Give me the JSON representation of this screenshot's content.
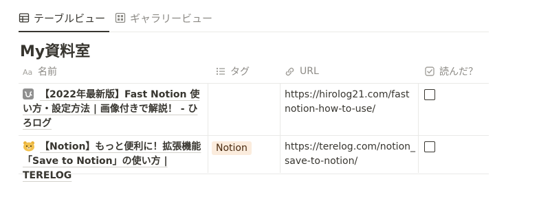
{
  "tabs": [
    {
      "label": "テーブルビュー",
      "icon": "table-icon",
      "active": true
    },
    {
      "label": "ギャラリービュー",
      "icon": "gallery-icon",
      "active": false
    }
  ],
  "database": {
    "title": "My資料室"
  },
  "columns": [
    {
      "label": "名前",
      "icon": "text-property-icon"
    },
    {
      "label": "タグ",
      "icon": "list-property-icon"
    },
    {
      "label": "URL",
      "icon": "link-icon"
    },
    {
      "label": "読んだ？",
      "icon": "checkbox-property-icon"
    }
  ],
  "rows": [
    {
      "name": "【2022年最新版】Fast Notion 使い方・設定方法 | 画像付きで解説！ - ひろログ",
      "page_icon": "hiragana-hi-icon",
      "tag": "",
      "url": "https://hirolog21.com/fastnotion-how-to-use/",
      "read": false
    },
    {
      "name": "【Notion】もっと便利に！拡張機能「Save to Notion」の使い方 | TERELOG",
      "page_icon": "bear-face-icon",
      "tag": "Notion",
      "url": "https://terelog.com/notion_save-to-notion/",
      "read": false
    }
  ],
  "colors": {
    "text": "#37352f",
    "muted": "#8c8a85",
    "border": "#e9e9e7",
    "tag_bg": "#fbecdd",
    "tag_text": "#49290e"
  }
}
